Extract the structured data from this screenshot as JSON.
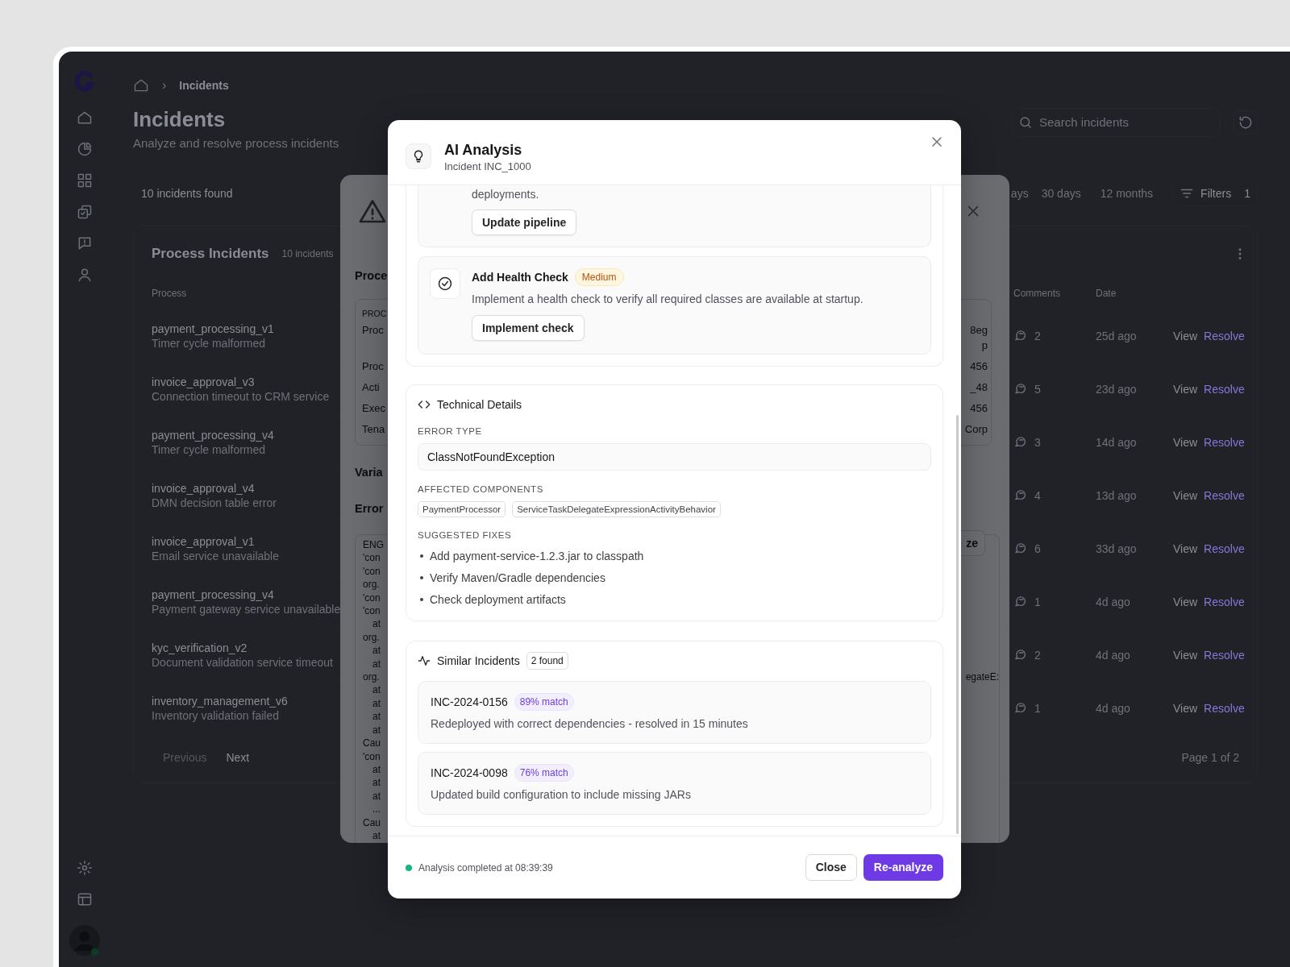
{
  "app": {
    "breadcrumb": {
      "separator": "›",
      "current": "Incidents"
    },
    "page": {
      "title": "Incidents",
      "subtitle": "Analyze and resolve process incidents"
    },
    "search": {
      "placeholder": "Search incidents"
    },
    "result_count": "10 incidents found",
    "time_ranges": [
      "ays",
      "30 days",
      "12 months"
    ],
    "filters": {
      "label": "Filters",
      "count": "1"
    },
    "table": {
      "title": "Process Incidents",
      "count": "10 incidents",
      "columns": [
        "Process",
        "Comments",
        "Date"
      ],
      "rows": [
        {
          "process": "payment_processing_v1",
          "error": "Timer cycle malformed",
          "comments": "2",
          "date": "25d ago",
          "actions": [
            "View",
            "Resolve"
          ]
        },
        {
          "process": "invoice_approval_v3",
          "error": "Connection timeout to CRM service",
          "comments": "5",
          "date": "23d ago",
          "actions": [
            "View",
            "Resolve"
          ]
        },
        {
          "process": "payment_processing_v4",
          "error": "Timer cycle malformed",
          "comments": "3",
          "date": "14d ago",
          "actions": [
            "View",
            "Resolve"
          ]
        },
        {
          "process": "invoice_approval_v4",
          "error": "DMN decision table error",
          "comments": "4",
          "date": "13d ago",
          "actions": [
            "View",
            "Resolve"
          ]
        },
        {
          "process": "invoice_approval_v1",
          "error": "Email service unavailable",
          "comments": "6",
          "date": "33d ago",
          "actions": [
            "View",
            "Resolve"
          ]
        },
        {
          "process": "payment_processing_v4",
          "error": "Payment gateway service unavailable",
          "comments": "1",
          "date": "4d ago",
          "actions": [
            "View",
            "Resolve"
          ]
        },
        {
          "process": "kyc_verification_v2",
          "error": "Document validation service timeout",
          "comments": "2",
          "date": "4d ago",
          "actions": [
            "View",
            "Resolve"
          ]
        },
        {
          "process": "inventory_management_v6",
          "error": "Inventory validation failed",
          "comments": "1",
          "date": "4d ago",
          "actions": [
            "View",
            "Resolve"
          ]
        }
      ]
    },
    "pagination": {
      "previous": "Previous",
      "previous_disabled": true,
      "next": "Next",
      "page_info": "Page 1 of 2"
    }
  },
  "detail_dialog": {
    "section_title": "Proce",
    "box_label": "PROC",
    "fields": [
      {
        "label": "Proc",
        "value": [
          "8eg",
          "p"
        ]
      },
      {
        "label": "Proc",
        "value": [
          "456"
        ]
      },
      {
        "label": "Acti",
        "value": [
          "_48"
        ]
      },
      {
        "label": "Exec",
        "value": [
          "456"
        ]
      },
      {
        "label": "Tena",
        "value": [
          "Corp"
        ]
      }
    ],
    "variables_title": "Varia",
    "error_title": "Error",
    "button_fragment": "ze",
    "code_lines": [
      {
        "text": "ENG",
        "indent": false
      },
      {
        "text": "'con",
        "indent": false
      },
      {
        "text": "'con",
        "indent": false
      },
      {
        "text": "org.",
        "indent": false
      },
      {
        "text": "'con",
        "indent": false
      },
      {
        "text": "'con",
        "indent": false
      },
      {
        "text": "at",
        "indent": true
      },
      {
        "text": "org.",
        "indent": false
      },
      {
        "text": "at",
        "indent": true
      },
      {
        "text": "at",
        "indent": true
      },
      {
        "text": "org.",
        "indent": false,
        "tail": "egateE:"
      },
      {
        "text": "at",
        "indent": true
      },
      {
        "text": "at",
        "indent": true
      },
      {
        "text": "at",
        "indent": true
      },
      {
        "text": "at",
        "indent": true
      },
      {
        "text": "Cau",
        "indent": false
      },
      {
        "text": "'con",
        "indent": false
      },
      {
        "text": "at",
        "indent": true
      },
      {
        "text": "at",
        "indent": true
      },
      {
        "text": "at",
        "indent": true
      },
      {
        "text": "...",
        "indent": true
      },
      {
        "text": "Cau",
        "indent": false
      },
      {
        "text": "at",
        "indent": true
      }
    ]
  },
  "analysis_dialog": {
    "title": "AI Analysis",
    "subtitle": "Incident INC_1000",
    "actions": [
      {
        "description": "deployments.",
        "button": "Update pipeline"
      },
      {
        "title": "Add Health Check",
        "priority": "Medium",
        "description": "Implement a health check to verify all required classes are available at startup.",
        "button": "Implement check"
      }
    ],
    "technical": {
      "title": "Technical Details",
      "error_type_label": "ERROR TYPE",
      "error_type": "ClassNotFoundException",
      "components_label": "AFFECTED COMPONENTS",
      "components": [
        "PaymentProcessor",
        "ServiceTaskDelegateExpressionActivityBehavior"
      ],
      "fixes_label": "SUGGESTED FIXES",
      "fixes": [
        "Add payment-service-1.2.3.jar to classpath",
        "Verify Maven/Gradle dependencies",
        "Check deployment artifacts"
      ]
    },
    "similar": {
      "title": "Similar Incidents",
      "count": "2 found",
      "items": [
        {
          "id": "INC-2024-0156",
          "match": "89% match",
          "resolution": "Redeployed with correct dependencies - resolved in 15 minutes"
        },
        {
          "id": "INC-2024-0098",
          "match": "76% match",
          "resolution": "Updated build configuration to include missing JARs"
        }
      ]
    },
    "status": "Analysis completed at 08:39:39",
    "buttons": [
      {
        "label": "Close",
        "kind": "secondary"
      },
      {
        "label": "Re-analyze",
        "kind": "primary"
      }
    ]
  }
}
